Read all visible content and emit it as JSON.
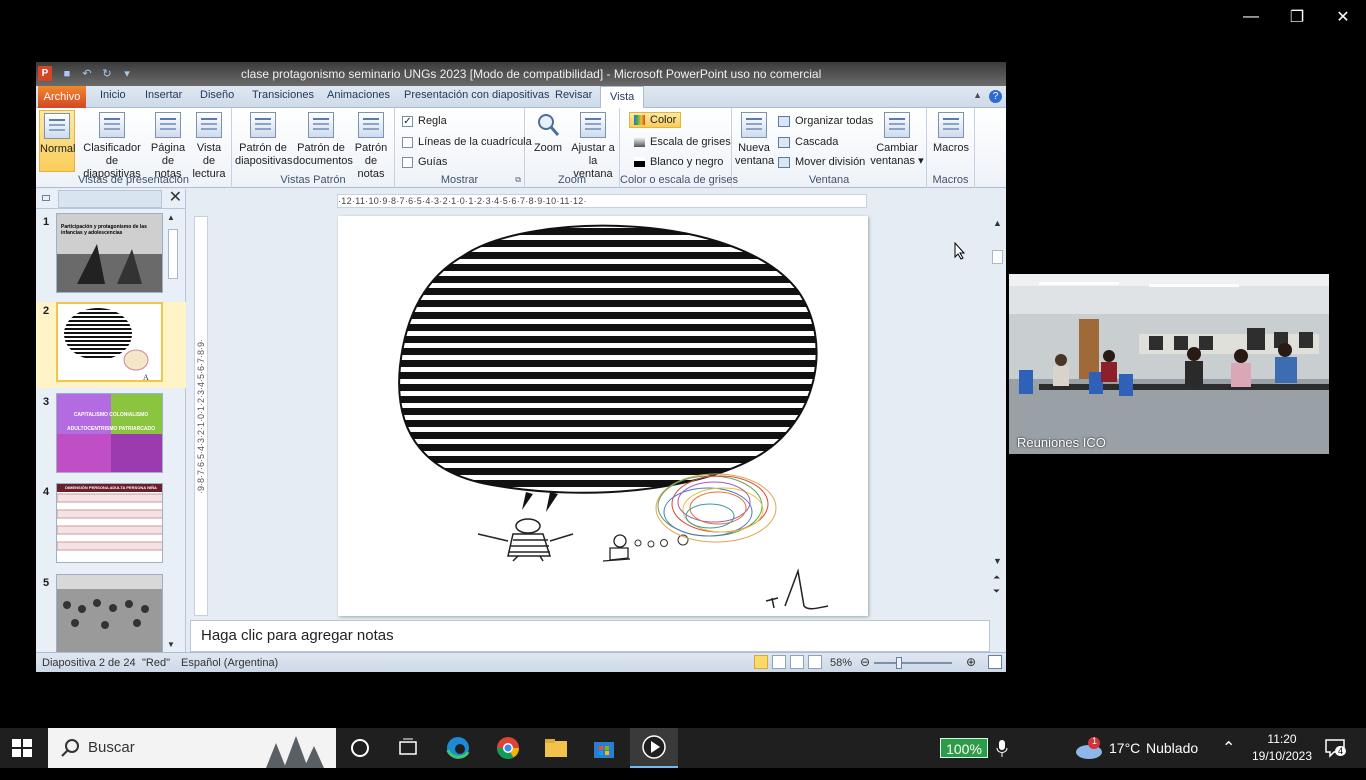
{
  "window": {
    "title": "clase protagonismo seminario UNGs 2023 [Modo de compatibilidad] - Microsoft PowerPoint uso no comercial",
    "app_icon_letter": "P",
    "minimize_label": "—",
    "restore_label": "❐",
    "close_label": "✕"
  },
  "ribbon_tabs": [
    "Archivo",
    "Inicio",
    "Insertar",
    "Diseño",
    "Transiciones",
    "Animaciones",
    "Presentación con diapositivas",
    "Revisar",
    "Vista"
  ],
  "ribbon": {
    "vistas_presentacion": {
      "label": "Vistas de presentación",
      "normal": "Normal",
      "clasificador": "Clasificador de diapositivas",
      "pagina_notas": "Página de notas",
      "vista_lectura": "Vista de lectura"
    },
    "vistas_patron": {
      "label": "Vistas Patrón",
      "patron_diapositivas": "Patrón de diapositivas",
      "patron_documentos": "Patrón de documentos",
      "patron_notas": "Patrón de notas"
    },
    "mostrar": {
      "label": "Mostrar",
      "regla": "Regla",
      "lineas": "Líneas de la cuadrícula",
      "guias": "Guías"
    },
    "zoom": {
      "label": "Zoom",
      "zoom": "Zoom",
      "ajustar": "Ajustar a la ventana"
    },
    "color": {
      "label": "Color o escala de grises",
      "color": "Color",
      "escala": "Escala de grises",
      "blanco": "Blanco y negro"
    },
    "ventana": {
      "label": "Ventana",
      "nueva": "Nueva ventana",
      "organizar": "Organizar todas",
      "cascada": "Cascada",
      "mover": "Mover división",
      "cambiar": "Cambiar ventanas ▾"
    },
    "macros": {
      "label": "Macros",
      "macros": "Macros"
    }
  },
  "thumbnails": [
    {
      "num": "1",
      "text": "Participación y protagonismo de las infancias y adolescencias"
    },
    {
      "num": "2",
      "text": ""
    },
    {
      "num": "3",
      "text": "CAPITALISMO COLONIALISMO ADULTOCENTRISMO PATRIARCADO"
    },
    {
      "num": "4",
      "text": "DIMENSIÓN PERSONA ADULTA PERSONA NIÑA"
    },
    {
      "num": "5",
      "text": ""
    }
  ],
  "ruler": {
    "horizontal": "·12·11·10·9·8·7·6·5·4·3·2·1·0·1·2·3·4·5·6·7·8·9·10·11·12·",
    "vertical": "·9·8·7·6·5·4·3·2·1·0·1·2·3·4·5·6·7·8·9·"
  },
  "notes_placeholder": "Haga clic para agregar notas",
  "status": {
    "slide": "Diapositiva 2 de 24",
    "theme": "\"Red\"",
    "language": "Español (Argentina)",
    "zoom": "58%"
  },
  "video": {
    "label": "Reuniones ICO"
  },
  "taskbar": {
    "search_placeholder": "Buscar",
    "battery": "100%",
    "weather_badge": "1",
    "temperature": "17°C",
    "weather": "Nublado",
    "time": "11:20",
    "date": "19/10/2023",
    "notifications": "4"
  },
  "colors": {
    "ribbon_file_tab": "#d24726",
    "selected_button": "#f9cd58",
    "taskbar_bg": "#1f1f1f"
  }
}
